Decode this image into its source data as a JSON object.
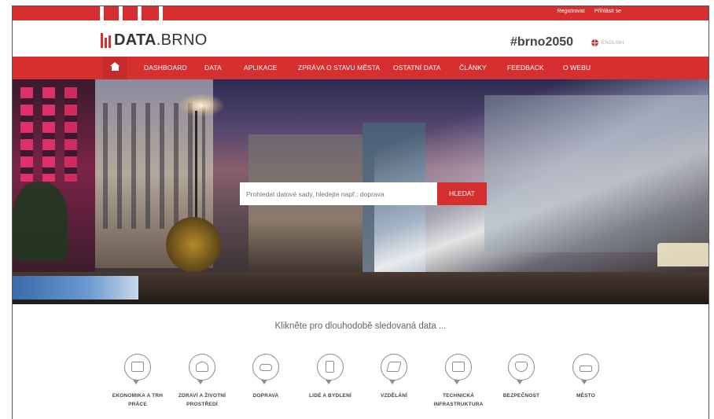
{
  "topbar": {
    "register": "Registrovat",
    "login": "Přihlásit se"
  },
  "header": {
    "logo_bold": "DATA",
    "logo_light": ".BRNO",
    "hashtag": "#brno2050",
    "language": "ENGLISH"
  },
  "nav": {
    "home_icon": "home-icon",
    "items": [
      "DASHBOARD",
      "DATA",
      "APLIKACE",
      "ZPRÁVA O STAVU MĚSTA",
      "OSTATNÍ DATA",
      "ČLÁNKY",
      "FEEDBACK",
      "O WEBU"
    ]
  },
  "search": {
    "placeholder": "Prohledat datové sady, hledejte např.: doprava",
    "button": "HLEDAT"
  },
  "tagline": "Klikněte pro dlouhodobě sledovaná data ...",
  "categories": [
    {
      "label": "EKONOMIKA A TRH PRÁCE",
      "icon": "chart-icon"
    },
    {
      "label": "ZDRAVÍ A ŽIVOTNÍ PROSTŘEDÍ",
      "icon": "tree-icon"
    },
    {
      "label": "DOPRAVA",
      "icon": "car-icon"
    },
    {
      "label": "LIDÉ A BYDLENÍ",
      "icon": "building-icon"
    },
    {
      "label": "VZDĚLÁNÍ",
      "icon": "graduation-cap-icon"
    },
    {
      "label": "TECHNICKÁ INFRASTRUKTURA",
      "icon": "infrastructure-icon"
    },
    {
      "label": "BEZPEČNOST",
      "icon": "security-icon"
    },
    {
      "label": "MĚSTO",
      "icon": "city-icon"
    }
  ],
  "colors": {
    "brand_red": "#d62f30",
    "text_dark": "#333333",
    "icon_gray": "#8d8d8d"
  }
}
